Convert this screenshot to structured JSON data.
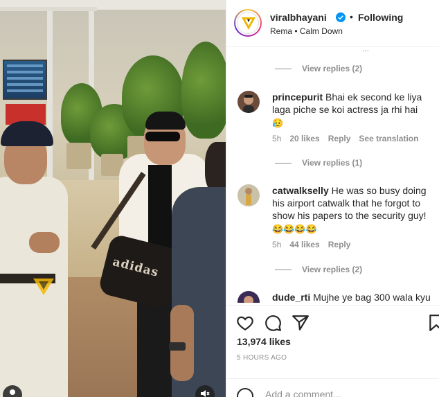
{
  "post": {
    "author": "viralbhayani",
    "separator": "•",
    "follow_status": "Following",
    "audio": "Rema • Calm Down",
    "likes": "13,974 likes",
    "time_ago": "5 HOURS AGO"
  },
  "media": {
    "bag_text": "adidas",
    "watermark_letter": "V"
  },
  "comments": {
    "partial_top": "...",
    "view_replies": [
      "View replies (2)",
      "View replies (1)",
      "View replies (2)"
    ],
    "items": [
      {
        "username": "princepurit",
        "text": "Bhai ek second ke liya laga piche se koi actress ja rhi hai",
        "emoji": "😥",
        "time": "5h",
        "likes": "20 likes",
        "reply": "Reply",
        "translate": "See translation"
      },
      {
        "username": "catwalkselly",
        "text": "He was so busy doing his airport catwalk that he forgot to show his papers to the security guy!",
        "emoji": "😂😂😂😂",
        "time": "5h",
        "likes": "44 likes",
        "reply": "Reply"
      },
      {
        "username": "dude_rti",
        "text": "Mujhe ye bag 300 wala kyu"
      }
    ]
  },
  "composer": {
    "placeholder": "Add a comment..."
  },
  "icons": {
    "like": "heart-icon",
    "comment": "comment-bubble-icon",
    "share": "paper-plane-icon",
    "save": "bookmark-icon",
    "emoji": "smiley-icon",
    "verified": "verified-badge-icon",
    "mute": "speaker-muted-icon",
    "tag": "user-tag-icon"
  },
  "colors": {
    "verified_blue": "#0095f6",
    "muted_text": "#8e8e8e",
    "text": "#262626",
    "brand_yellow": "#f2b705"
  }
}
